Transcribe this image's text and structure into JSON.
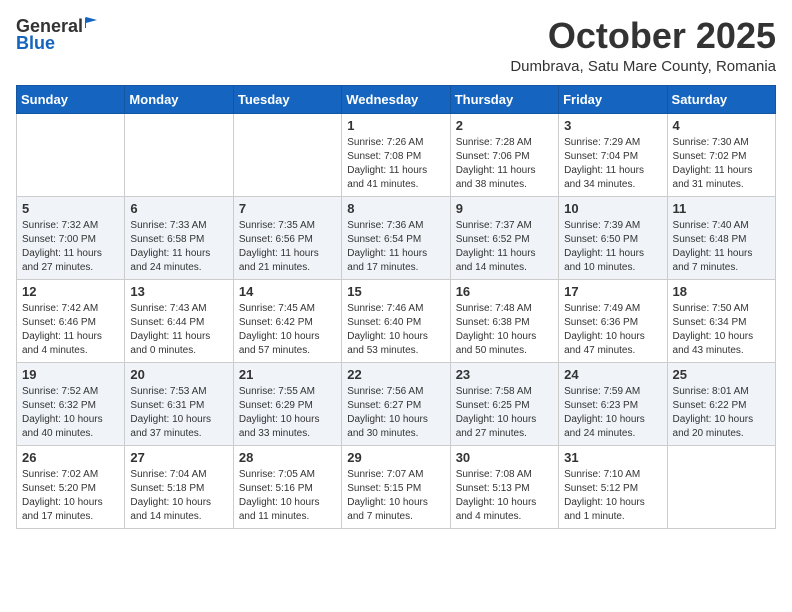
{
  "header": {
    "logo_general": "General",
    "logo_blue": "Blue",
    "month_title": "October 2025",
    "location": "Dumbrava, Satu Mare County, Romania"
  },
  "weekdays": [
    "Sunday",
    "Monday",
    "Tuesday",
    "Wednesday",
    "Thursday",
    "Friday",
    "Saturday"
  ],
  "weeks": [
    [
      {
        "day": "",
        "info": ""
      },
      {
        "day": "",
        "info": ""
      },
      {
        "day": "",
        "info": ""
      },
      {
        "day": "1",
        "info": "Sunrise: 7:26 AM\nSunset: 7:08 PM\nDaylight: 11 hours\nand 41 minutes."
      },
      {
        "day": "2",
        "info": "Sunrise: 7:28 AM\nSunset: 7:06 PM\nDaylight: 11 hours\nand 38 minutes."
      },
      {
        "day": "3",
        "info": "Sunrise: 7:29 AM\nSunset: 7:04 PM\nDaylight: 11 hours\nand 34 minutes."
      },
      {
        "day": "4",
        "info": "Sunrise: 7:30 AM\nSunset: 7:02 PM\nDaylight: 11 hours\nand 31 minutes."
      }
    ],
    [
      {
        "day": "5",
        "info": "Sunrise: 7:32 AM\nSunset: 7:00 PM\nDaylight: 11 hours\nand 27 minutes."
      },
      {
        "day": "6",
        "info": "Sunrise: 7:33 AM\nSunset: 6:58 PM\nDaylight: 11 hours\nand 24 minutes."
      },
      {
        "day": "7",
        "info": "Sunrise: 7:35 AM\nSunset: 6:56 PM\nDaylight: 11 hours\nand 21 minutes."
      },
      {
        "day": "8",
        "info": "Sunrise: 7:36 AM\nSunset: 6:54 PM\nDaylight: 11 hours\nand 17 minutes."
      },
      {
        "day": "9",
        "info": "Sunrise: 7:37 AM\nSunset: 6:52 PM\nDaylight: 11 hours\nand 14 minutes."
      },
      {
        "day": "10",
        "info": "Sunrise: 7:39 AM\nSunset: 6:50 PM\nDaylight: 11 hours\nand 10 minutes."
      },
      {
        "day": "11",
        "info": "Sunrise: 7:40 AM\nSunset: 6:48 PM\nDaylight: 11 hours\nand 7 minutes."
      }
    ],
    [
      {
        "day": "12",
        "info": "Sunrise: 7:42 AM\nSunset: 6:46 PM\nDaylight: 11 hours\nand 4 minutes."
      },
      {
        "day": "13",
        "info": "Sunrise: 7:43 AM\nSunset: 6:44 PM\nDaylight: 11 hours\nand 0 minutes."
      },
      {
        "day": "14",
        "info": "Sunrise: 7:45 AM\nSunset: 6:42 PM\nDaylight: 10 hours\nand 57 minutes."
      },
      {
        "day": "15",
        "info": "Sunrise: 7:46 AM\nSunset: 6:40 PM\nDaylight: 10 hours\nand 53 minutes."
      },
      {
        "day": "16",
        "info": "Sunrise: 7:48 AM\nSunset: 6:38 PM\nDaylight: 10 hours\nand 50 minutes."
      },
      {
        "day": "17",
        "info": "Sunrise: 7:49 AM\nSunset: 6:36 PM\nDaylight: 10 hours\nand 47 minutes."
      },
      {
        "day": "18",
        "info": "Sunrise: 7:50 AM\nSunset: 6:34 PM\nDaylight: 10 hours\nand 43 minutes."
      }
    ],
    [
      {
        "day": "19",
        "info": "Sunrise: 7:52 AM\nSunset: 6:32 PM\nDaylight: 10 hours\nand 40 minutes."
      },
      {
        "day": "20",
        "info": "Sunrise: 7:53 AM\nSunset: 6:31 PM\nDaylight: 10 hours\nand 37 minutes."
      },
      {
        "day": "21",
        "info": "Sunrise: 7:55 AM\nSunset: 6:29 PM\nDaylight: 10 hours\nand 33 minutes."
      },
      {
        "day": "22",
        "info": "Sunrise: 7:56 AM\nSunset: 6:27 PM\nDaylight: 10 hours\nand 30 minutes."
      },
      {
        "day": "23",
        "info": "Sunrise: 7:58 AM\nSunset: 6:25 PM\nDaylight: 10 hours\nand 27 minutes."
      },
      {
        "day": "24",
        "info": "Sunrise: 7:59 AM\nSunset: 6:23 PM\nDaylight: 10 hours\nand 24 minutes."
      },
      {
        "day": "25",
        "info": "Sunrise: 8:01 AM\nSunset: 6:22 PM\nDaylight: 10 hours\nand 20 minutes."
      }
    ],
    [
      {
        "day": "26",
        "info": "Sunrise: 7:02 AM\nSunset: 5:20 PM\nDaylight: 10 hours\nand 17 minutes."
      },
      {
        "day": "27",
        "info": "Sunrise: 7:04 AM\nSunset: 5:18 PM\nDaylight: 10 hours\nand 14 minutes."
      },
      {
        "day": "28",
        "info": "Sunrise: 7:05 AM\nSunset: 5:16 PM\nDaylight: 10 hours\nand 11 minutes."
      },
      {
        "day": "29",
        "info": "Sunrise: 7:07 AM\nSunset: 5:15 PM\nDaylight: 10 hours\nand 7 minutes."
      },
      {
        "day": "30",
        "info": "Sunrise: 7:08 AM\nSunset: 5:13 PM\nDaylight: 10 hours\nand 4 minutes."
      },
      {
        "day": "31",
        "info": "Sunrise: 7:10 AM\nSunset: 5:12 PM\nDaylight: 10 hours\nand 1 minute."
      },
      {
        "day": "",
        "info": ""
      }
    ]
  ]
}
